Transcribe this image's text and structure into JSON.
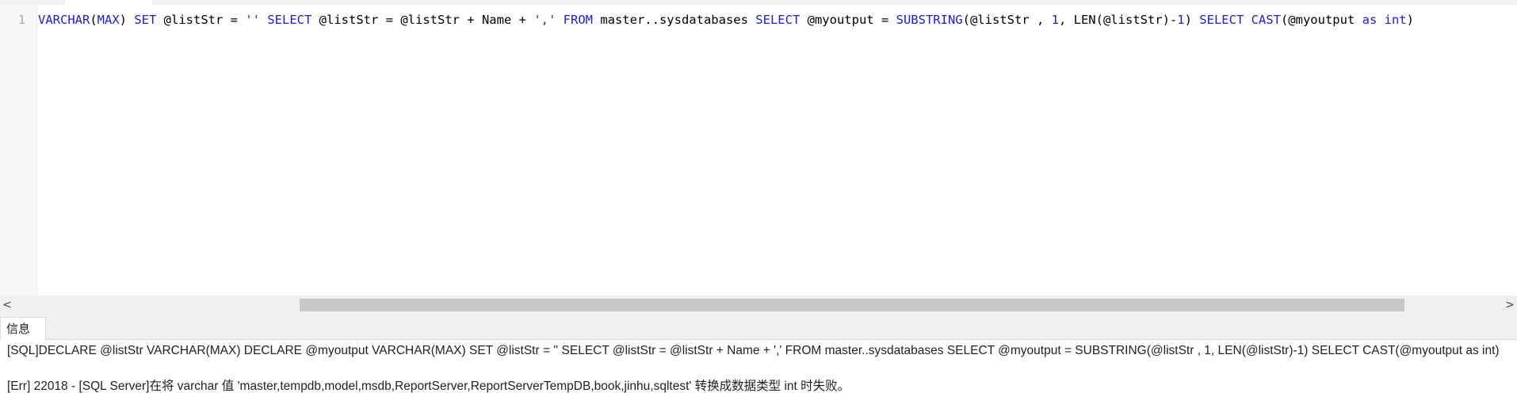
{
  "editor": {
    "line_numbers": [
      "1"
    ],
    "code_tokens": [
      {
        "t": "VARCHAR",
        "c": "kw"
      },
      {
        "t": "(",
        "c": ""
      },
      {
        "t": "MAX",
        "c": "kw"
      },
      {
        "t": ") ",
        "c": ""
      },
      {
        "t": "SET",
        "c": "kw"
      },
      {
        "t": " @listStr = ",
        "c": ""
      },
      {
        "t": "''",
        "c": "str"
      },
      {
        "t": " ",
        "c": ""
      },
      {
        "t": "SELECT",
        "c": "kw"
      },
      {
        "t": " @listStr = @listStr + Name + ",
        "c": ""
      },
      {
        "t": "','",
        "c": "str"
      },
      {
        "t": " ",
        "c": ""
      },
      {
        "t": "FROM",
        "c": "kw"
      },
      {
        "t": " master..sysdatabases ",
        "c": ""
      },
      {
        "t": "SELECT",
        "c": "kw"
      },
      {
        "t": " @myoutput = ",
        "c": ""
      },
      {
        "t": "SUBSTRING",
        "c": "kw"
      },
      {
        "t": "(@listStr , ",
        "c": ""
      },
      {
        "t": "1",
        "c": "num"
      },
      {
        "t": ", LEN(@listStr)-",
        "c": ""
      },
      {
        "t": "1",
        "c": "num"
      },
      {
        "t": ") ",
        "c": ""
      },
      {
        "t": "SELECT",
        "c": "kw"
      },
      {
        "t": " ",
        "c": ""
      },
      {
        "t": "CAST",
        "c": "kw"
      },
      {
        "t": "(@myoutput ",
        "c": ""
      },
      {
        "t": "as",
        "c": "kw"
      },
      {
        "t": " ",
        "c": ""
      },
      {
        "t": "int",
        "c": "kw"
      },
      {
        "t": ")",
        "c": ""
      }
    ]
  },
  "scrollbar": {
    "left_arrow": "<",
    "right_arrow": ">"
  },
  "results": {
    "tab_label": "信息",
    "messages": [
      "[SQL]DECLARE @listStr VARCHAR(MAX) DECLARE @myoutput VARCHAR(MAX) SET @listStr = '' SELECT @listStr = @listStr + Name + ',' FROM master..sysdatabases SELECT @myoutput = SUBSTRING(@listStr , 1, LEN(@listStr)-1) SELECT CAST(@myoutput as int)",
      "[Err] 22018 - [SQL Server]在将 varchar 值 'master,tempdb,model,msdb,ReportServer,ReportServerTempDB,book,jinhu,sqltest' 转换成数据类型 int 时失败。"
    ]
  }
}
